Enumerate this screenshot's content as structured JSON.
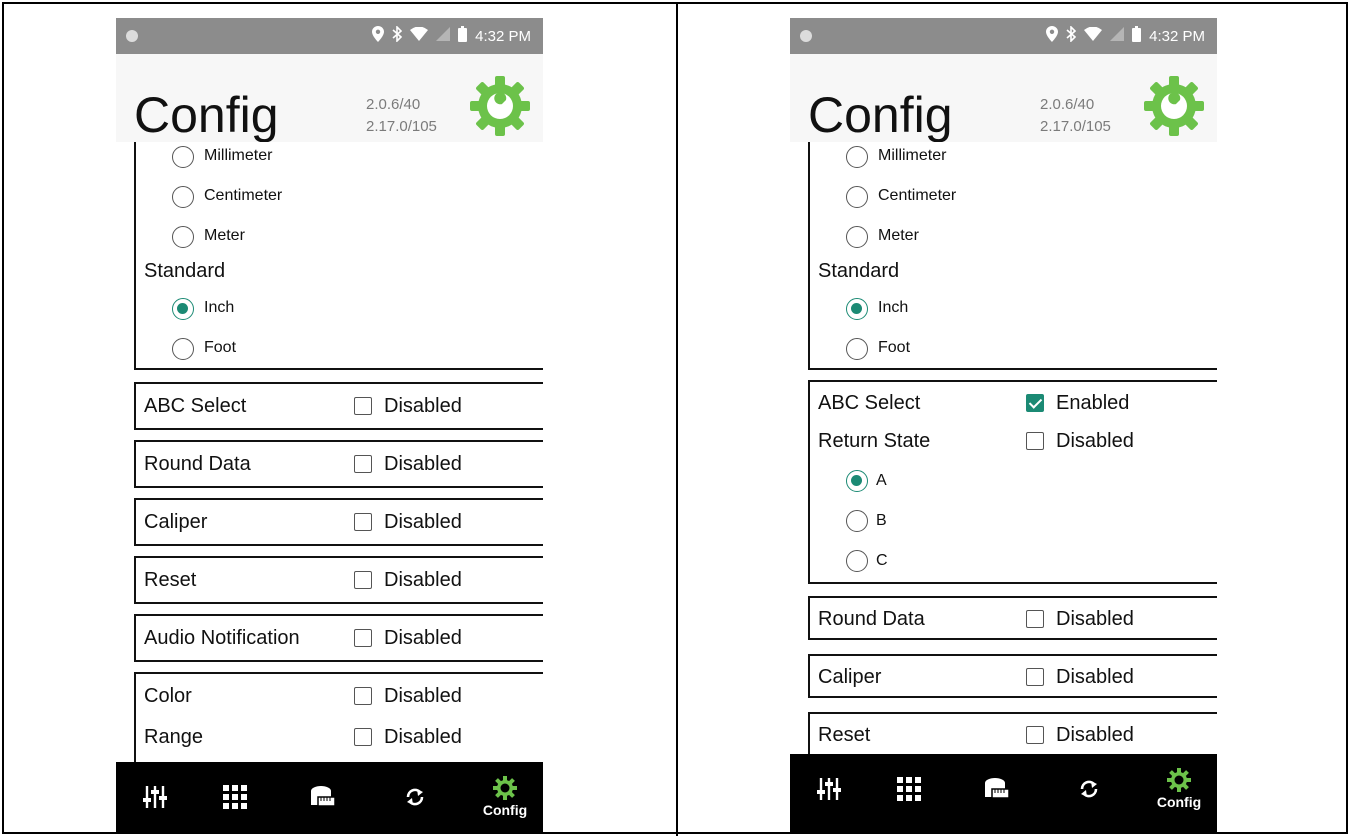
{
  "left": {
    "status": {
      "time": "4:32 PM"
    },
    "header": {
      "title": "Config",
      "version_1": "2.0.6/40",
      "version_2": "2.17.0/105"
    },
    "units": {
      "metric_options": [
        "Millimeter",
        "Centimeter",
        "Meter"
      ],
      "standard_label": "Standard",
      "standard_options": [
        "Inch",
        "Foot"
      ],
      "selected": "Inch"
    },
    "settings": [
      {
        "label": "ABC Select",
        "state": "Disabled"
      },
      {
        "label": "Round Data",
        "state": "Disabled"
      },
      {
        "label": "Caliper",
        "state": "Disabled"
      },
      {
        "label": "Reset",
        "state": "Disabled"
      },
      {
        "label": "Audio Notification",
        "state": "Disabled"
      }
    ],
    "color_box": {
      "color_label": "Color",
      "color_state": "Disabled",
      "range_label": "Range",
      "range_state": "Disabled"
    },
    "nav": {
      "config_label": "Config"
    }
  },
  "right": {
    "status": {
      "time": "4:32 PM"
    },
    "header": {
      "title": "Config",
      "version_1": "2.0.6/40",
      "version_2": "2.17.0/105"
    },
    "units": {
      "metric_options": [
        "Millimeter",
        "Centimeter",
        "Meter"
      ],
      "standard_label": "Standard",
      "standard_options": [
        "Inch",
        "Foot"
      ],
      "selected": "Inch"
    },
    "abc_box": {
      "abc_label": "ABC Select",
      "abc_state": "Enabled",
      "return_label": "Return State",
      "return_state": "Disabled",
      "options": [
        "A",
        "B",
        "C"
      ],
      "selected": "A"
    },
    "settings": [
      {
        "label": "Round Data",
        "state": "Disabled"
      },
      {
        "label": "Caliper",
        "state": "Disabled"
      },
      {
        "label": "Reset",
        "state": "Disabled"
      }
    ],
    "nav": {
      "config_label": "Config"
    }
  },
  "colors": {
    "accent": "#1b8a74",
    "gear": "#6cc24a",
    "navbar": "#000000",
    "statusbar": "#8c8c8c"
  },
  "icons": [
    "location-icon",
    "bluetooth-icon",
    "wifi-icon",
    "signal-icon",
    "battery-icon",
    "sliders-icon",
    "grid-icon",
    "tape-icon",
    "sync-icon",
    "gear-icon"
  ]
}
